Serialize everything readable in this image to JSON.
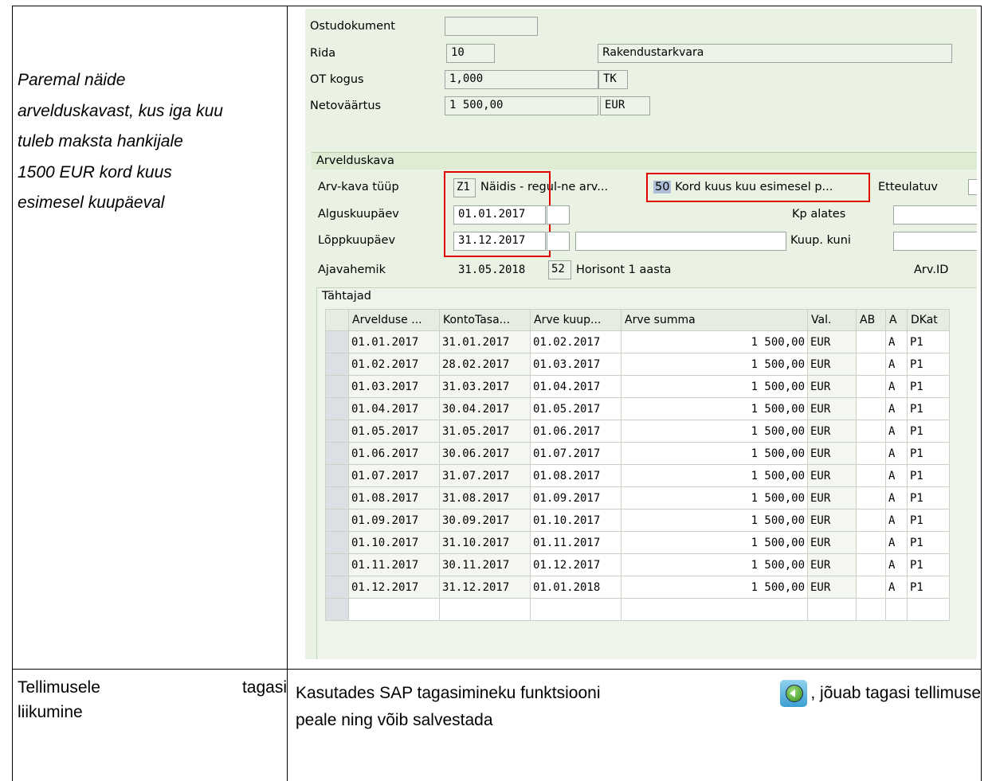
{
  "left_description": [
    "Paremal näide",
    "arvelduskavast, kus iga kuu",
    "tuleb maksta hankijale",
    "1500 EUR kord kuus",
    "esimesel kuupäeval"
  ],
  "bottom_left": {
    "word1": "Tellimusele",
    "word2": "tagasi",
    "line2": "liikumine"
  },
  "bottom_right": {
    "part1": "Kasutades SAP tagasimineku funktsiooni",
    "part2": ", jõuab tagasi tellimuse",
    "line2": "peale ning võib salvestada",
    "icon": "back-icon"
  },
  "header_fields": {
    "ostudokument_label": "Ostudokument",
    "ostudokument_value": "",
    "rida_label": "Rida",
    "rida_value": "10",
    "rida_text": "Rakendustarkvara",
    "ot_kogus_label": "OT kogus",
    "ot_kogus_value": "1,000",
    "ot_kogus_unit": "TK",
    "netovaartus_label": "Netoväärtus",
    "netovaartus_value": "1 500,00",
    "netovaartus_currency": "EUR"
  },
  "section": {
    "title": "Arvelduskava",
    "arv_kava_tyyp_label": "Arv-kava tüüp",
    "arv_kava_code": "Z1",
    "arv_kava_text": "Näidis - regul-ne arv...",
    "rule_code": "50",
    "rule_text": "Kord kuus kuu esimesel p...",
    "etteulatuv_label": "Etteulatuv",
    "alguskuupaev_label": "Alguskuupäev",
    "alguskuupaev_value": "01.01.2017",
    "kp_alates_label": "Kp alates",
    "loppkuupaev_label": "Lõppkuupäev",
    "loppkuupaev_value": "31.12.2017",
    "kuup_kuni_label": "Kuup. kuni",
    "ajavahemik_label": "Ajavahemik",
    "ajavahemik_value": "31.05.2018",
    "horizon_code": "52",
    "horizon_text": "Horisont 1 aasta",
    "arv_id_label": "Arv.ID"
  },
  "grid": {
    "title": "Tähtajad",
    "columns": [
      "Arvelduse ...",
      "KontoTasa...",
      "Arve kuup...",
      "Arve summa",
      "Val.",
      "AB",
      "A",
      "DKat"
    ],
    "rows": [
      [
        "01.01.2017",
        "31.01.2017",
        "01.02.2017",
        "1 500,00",
        "EUR",
        "",
        "A",
        "P1"
      ],
      [
        "01.02.2017",
        "28.02.2017",
        "01.03.2017",
        "1 500,00",
        "EUR",
        "",
        "A",
        "P1"
      ],
      [
        "01.03.2017",
        "31.03.2017",
        "01.04.2017",
        "1 500,00",
        "EUR",
        "",
        "A",
        "P1"
      ],
      [
        "01.04.2017",
        "30.04.2017",
        "01.05.2017",
        "1 500,00",
        "EUR",
        "",
        "A",
        "P1"
      ],
      [
        "01.05.2017",
        "31.05.2017",
        "01.06.2017",
        "1 500,00",
        "EUR",
        "",
        "A",
        "P1"
      ],
      [
        "01.06.2017",
        "30.06.2017",
        "01.07.2017",
        "1 500,00",
        "EUR",
        "",
        "A",
        "P1"
      ],
      [
        "01.07.2017",
        "31.07.2017",
        "01.08.2017",
        "1 500,00",
        "EUR",
        "",
        "A",
        "P1"
      ],
      [
        "01.08.2017",
        "31.08.2017",
        "01.09.2017",
        "1 500,00",
        "EUR",
        "",
        "A",
        "P1"
      ],
      [
        "01.09.2017",
        "30.09.2017",
        "01.10.2017",
        "1 500,00",
        "EUR",
        "",
        "A",
        "P1"
      ],
      [
        "01.10.2017",
        "31.10.2017",
        "01.11.2017",
        "1 500,00",
        "EUR",
        "",
        "A",
        "P1"
      ],
      [
        "01.11.2017",
        "30.11.2017",
        "01.12.2017",
        "1 500,00",
        "EUR",
        "",
        "A",
        "P1"
      ],
      [
        "01.12.2017",
        "31.12.2017",
        "01.01.2018",
        "1 500,00",
        "EUR",
        "",
        "A",
        "P1"
      ]
    ]
  }
}
